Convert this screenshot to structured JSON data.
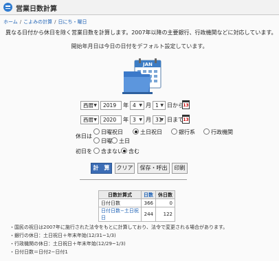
{
  "header": {
    "title": "営業日数計算"
  },
  "breadcrumb": [
    "ホーム",
    "こよみの計算",
    "日にち・曜日"
  ],
  "description": "異なる日付から休日を除く営業日数を計算します。2007年以降の主要銀行、行政機関などに対応しています。",
  "note": "開始年月日は今日の日付をデフォルト設定しています。",
  "illustration": {
    "calendar_label": "JAN"
  },
  "start": {
    "era": "西暦",
    "year": "2019",
    "month": "4",
    "day": "1",
    "year_unit": "年",
    "month_unit": "月",
    "day_suffix": "日から"
  },
  "end": {
    "era": "西暦",
    "year": "2020",
    "month": "3",
    "day": "31",
    "year_unit": "年",
    "month_unit": "月",
    "day_suffix": "日まで"
  },
  "calendar_button": {
    "text": "13"
  },
  "holiday": {
    "label": "休日は",
    "options": [
      "日曜祝日",
      "土日祝日",
      "銀行系",
      "行政機関",
      "日曜",
      "土日"
    ],
    "selected": "土日祝日"
  },
  "first_day": {
    "label": "初日を",
    "options": [
      "含まない",
      "含む"
    ],
    "selected": "含む"
  },
  "buttons": {
    "calc": "計　算",
    "clear": "クリア",
    "save": "保存・呼出",
    "print": "印刷"
  },
  "results": {
    "headers": [
      "日数計算式",
      "日数",
      "休日数"
    ],
    "rows": [
      {
        "label": "日付日数",
        "days": "366",
        "holidays": "0"
      },
      {
        "label": "日付日数−土日祝日",
        "days": "244",
        "holidays": "122"
      }
    ]
  },
  "notes": [
    "・国民の祝日は2007年に施行された法令をもとに計算しており、法令で変更される場合があります。",
    "・銀行の休日：土日祝日＋年末年始(12/31~1/3)",
    "・行政機関の休日：土日祝日＋年末年始(12/29~1/3)",
    "・日付日数＝日付2−日付1"
  ],
  "colors": {
    "accent": "#3c6db5",
    "link": "#1a5fb4",
    "icon": "#2f7bd0"
  }
}
